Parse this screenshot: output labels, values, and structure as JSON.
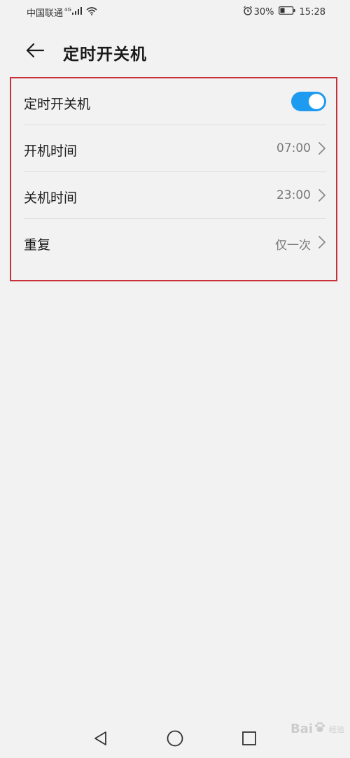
{
  "status_bar": {
    "carrier": "中国联通",
    "network": "4G",
    "battery_percent": "30%",
    "time": "15:28",
    "icons": [
      "signal-icon",
      "wifi-icon",
      "alarm-icon",
      "battery-icon"
    ]
  },
  "header": {
    "title": "定时开关机",
    "back_icon": "arrow-left-icon"
  },
  "settings": {
    "toggle": {
      "label": "定时开关机",
      "enabled": true,
      "accent_color": "#1d9bf0"
    },
    "items": [
      {
        "label": "开机时间",
        "value": "07:00",
        "icon": "chevron-right-icon"
      },
      {
        "label": "关机时间",
        "value": "23:00",
        "icon": "chevron-right-icon"
      },
      {
        "label": "重复",
        "value": "仅一次",
        "icon": "chevron-right-icon"
      }
    ],
    "highlight_color": "#c9313a"
  },
  "nav_bar": {
    "icons": [
      "nav-back-icon",
      "nav-home-icon",
      "nav-recent-icon"
    ]
  },
  "watermark": {
    "text_left": "Bai",
    "text_right": "经验"
  }
}
